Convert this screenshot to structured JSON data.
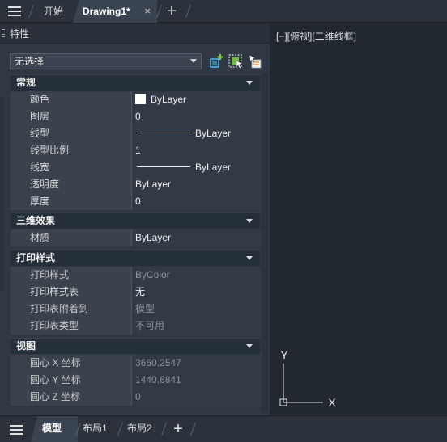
{
  "top_tabs": {
    "start": "开始",
    "drawing": "Drawing1*",
    "close": "×",
    "add": "+"
  },
  "panel": {
    "title": "特性",
    "selection": "无选择",
    "sections": [
      {
        "title": "常规",
        "rows": [
          {
            "label": "颜色",
            "value": "ByLayer"
          },
          {
            "label": "图层",
            "value": "0"
          },
          {
            "label": "线型",
            "value": "ByLayer"
          },
          {
            "label": "线型比例",
            "value": "1"
          },
          {
            "label": "线宽",
            "value": "ByLayer"
          },
          {
            "label": "透明度",
            "value": "ByLayer"
          },
          {
            "label": "厚度",
            "value": "0"
          }
        ]
      },
      {
        "title": "三维效果",
        "rows": [
          {
            "label": "材质",
            "value": "ByLayer"
          }
        ]
      },
      {
        "title": "打印样式",
        "rows": [
          {
            "label": "打印样式",
            "value": "ByColor"
          },
          {
            "label": "打印样式表",
            "value": "无"
          },
          {
            "label": "打印表附着到",
            "value": "模型"
          },
          {
            "label": "打印表类型",
            "value": "不可用"
          }
        ]
      },
      {
        "title": "视图",
        "rows": [
          {
            "label": "圆心 X 坐标",
            "value": "3660.2547"
          },
          {
            "label": "圆心 Y 坐标",
            "value": "1440.6841"
          },
          {
            "label": "圆心 Z 坐标",
            "value": "0"
          }
        ]
      }
    ]
  },
  "viewport": {
    "label": "[−][俯视][二维线框]",
    "ucs_x": "X",
    "ucs_y": "Y"
  },
  "bottom_tabs": {
    "model": "模型",
    "layout1": "布局1",
    "layout2": "布局2",
    "add": "+"
  },
  "colors": {
    "background": "#212830",
    "panel": "#303843",
    "accent_icon": "#4fb8e8"
  }
}
